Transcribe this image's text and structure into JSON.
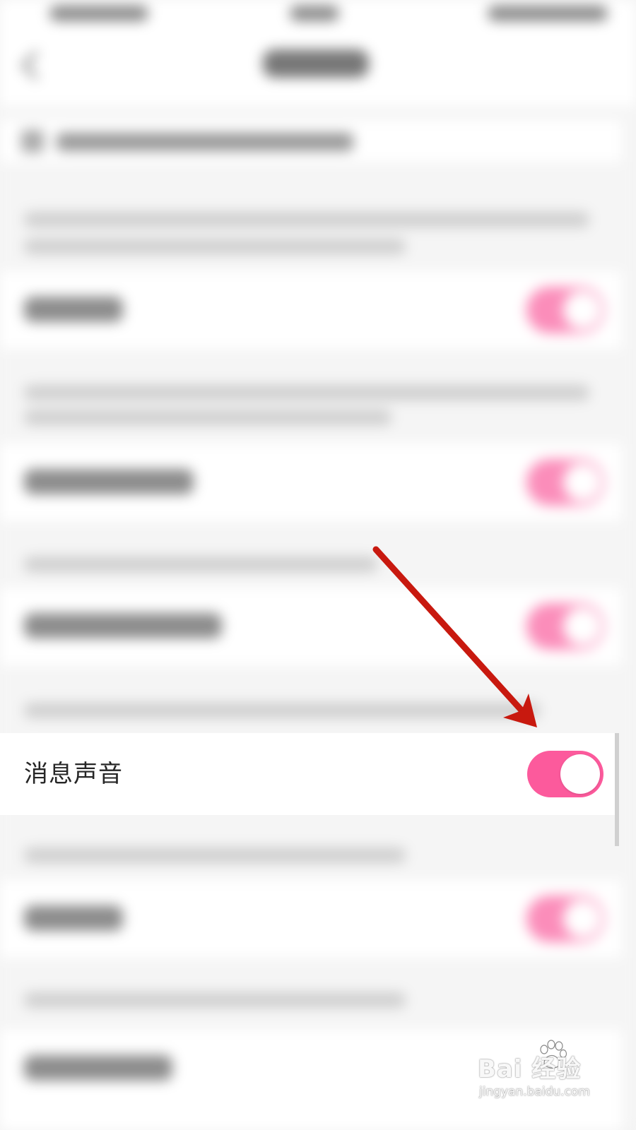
{
  "setting": {
    "label": "消息声音",
    "enabled": true
  },
  "watermark": {
    "brand": "Bai  经验",
    "url": "jingyan.baidu.com"
  },
  "colors": {
    "toggle_on": "#fc5a9c",
    "annotation_arrow": "#c8190f",
    "background": "#f4f4f4"
  },
  "icons": {
    "back": "back-arrow-icon",
    "annotation": "red-arrow-icon",
    "logo": "baidu-paw-icon"
  }
}
